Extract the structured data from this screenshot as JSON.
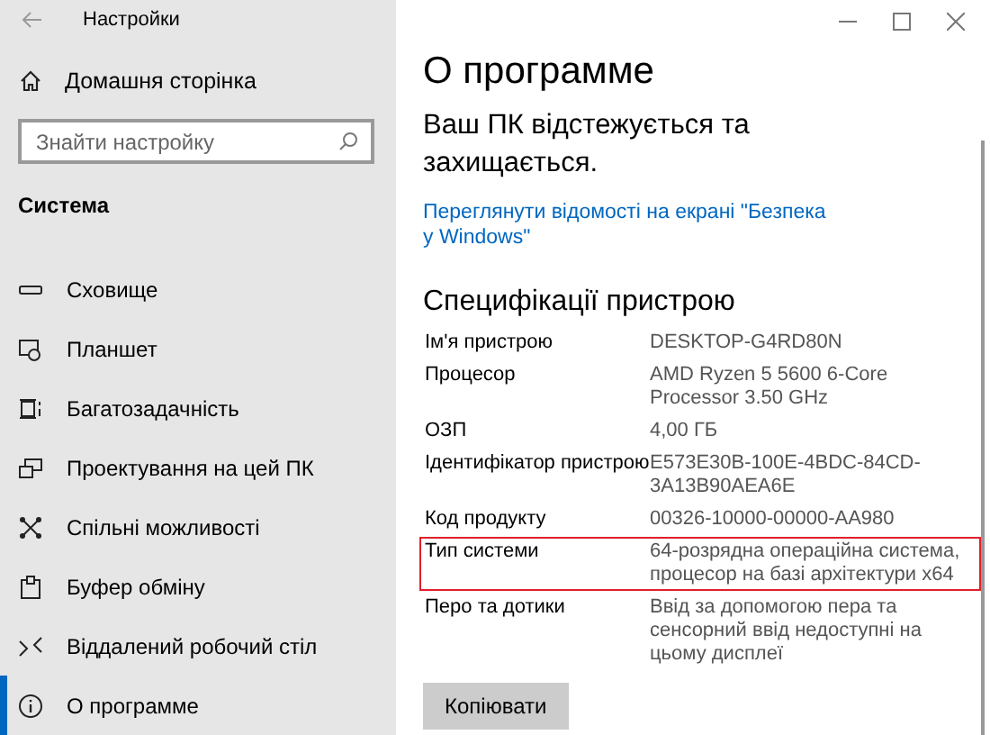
{
  "window": {
    "title": "Настройки"
  },
  "sidebar": {
    "home": "Домашня сторінка",
    "search": {
      "placeholder": "Знайти настройку"
    },
    "section": "Система",
    "items": [
      {
        "label": "Сховище",
        "selected": false
      },
      {
        "label": "Планшет",
        "selected": false
      },
      {
        "label": "Багатозадачність",
        "selected": false
      },
      {
        "label": "Проектування на цей ПК",
        "selected": false
      },
      {
        "label": "Спільні можливості",
        "selected": false
      },
      {
        "label": "Буфер обміну",
        "selected": false
      },
      {
        "label": "Віддалений робочий стіл",
        "selected": false
      },
      {
        "label": "О программе",
        "selected": true
      }
    ]
  },
  "main": {
    "title": "О программе",
    "status": "Ваш ПК відстежується та захищається.",
    "link": "Переглянути відомості на екрані \"Безпека у Windows\"",
    "specs_heading": "Специфікації пристрою",
    "specs": [
      {
        "label": "Ім'я пристрою",
        "value": "DESKTOP-G4RD80N",
        "highlighted": false
      },
      {
        "label": "Процесор",
        "value": "AMD Ryzen 5 5600 6-Core Processor 3.50 GHz",
        "highlighted": false
      },
      {
        "label": "ОЗП",
        "value": "4,00 ГБ",
        "highlighted": false
      },
      {
        "label": "Ідентифікатор пристрою",
        "value": "E573E30B-100E-4BDC-84CD-3A13B90AEA6E",
        "highlighted": false
      },
      {
        "label": "Код продукту",
        "value": "00326-10000-00000-AA980",
        "highlighted": false
      },
      {
        "label": "Тип системи",
        "value": "64-розрядна операційна система, процесор на базі архітектури x64",
        "highlighted": true
      },
      {
        "label": "Перо та дотики",
        "value": "Ввід за допомогою пера та сенсорний ввід недоступні на цьому дисплеї",
        "highlighted": false
      }
    ],
    "copy_button": "Копіювати"
  }
}
